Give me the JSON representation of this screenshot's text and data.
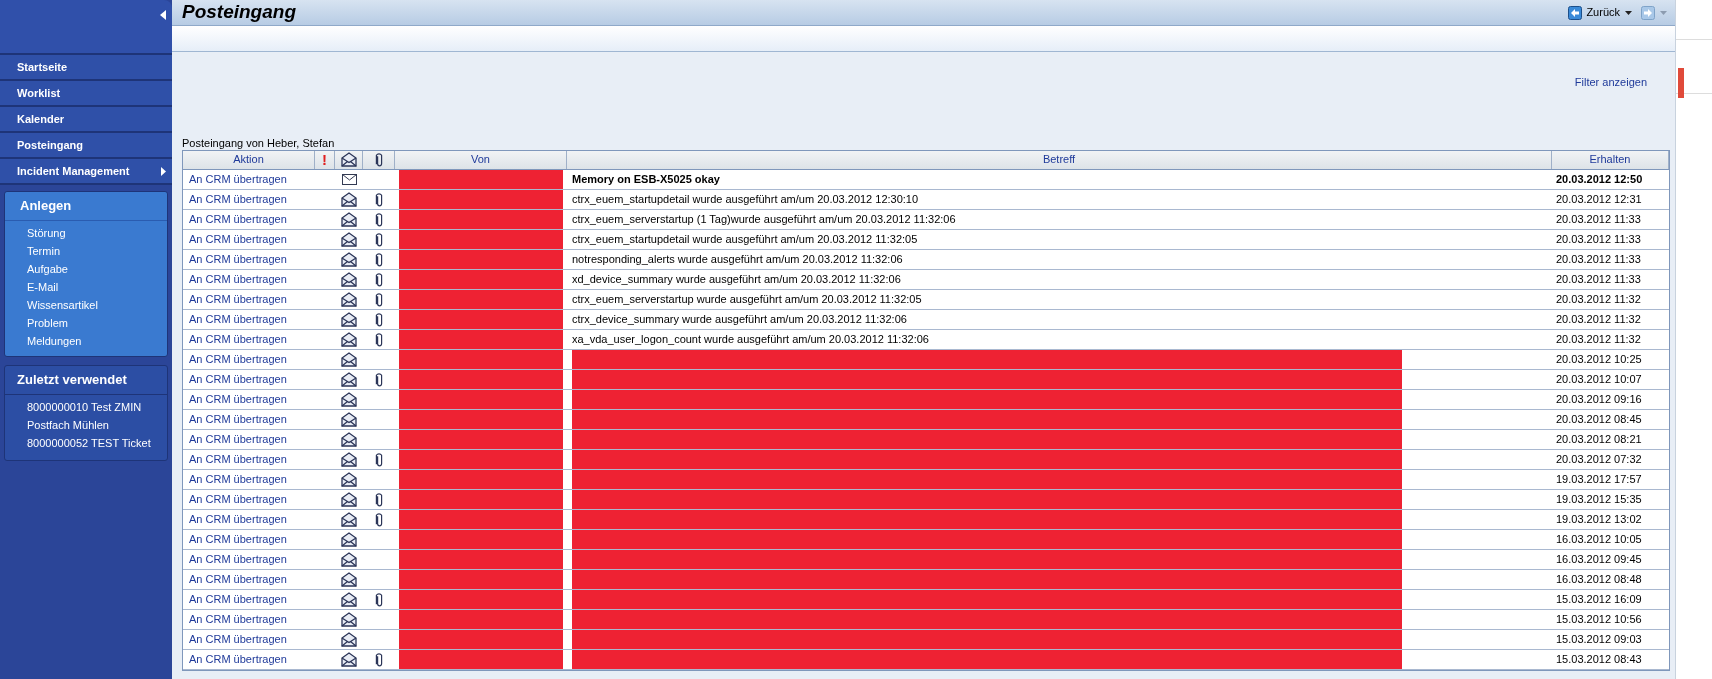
{
  "sidebar": {
    "nav": [
      {
        "label": "Startseite",
        "expandable": false
      },
      {
        "label": "Worklist",
        "expandable": false
      },
      {
        "label": "Kalender",
        "expandable": false
      },
      {
        "label": "Posteingang",
        "expandable": false
      },
      {
        "label": "Incident Management",
        "expandable": true
      }
    ],
    "create": {
      "title": "Anlegen",
      "items": [
        "Störung",
        "Termin",
        "Aufgabe",
        "E-Mail",
        "Wissensartikel",
        "Problem",
        "Meldungen"
      ]
    },
    "recent": {
      "title": "Zuletzt verwendet",
      "items": [
        "8000000010 Test ZMIN",
        "Postfach Mühlen",
        "8000000052 TEST Ticket"
      ]
    }
  },
  "header": {
    "title": "Posteingang",
    "back_button": "Zurück",
    "forward_enabled": false
  },
  "filter_link": "Filter anzeigen",
  "inbox_owner": "Posteingang von Heber, Stefan",
  "table": {
    "columns": [
      {
        "kind": "text",
        "label": "Aktion"
      },
      {
        "kind": "priority",
        "label": "!"
      },
      {
        "kind": "read"
      },
      {
        "kind": "attachment"
      },
      {
        "kind": "text",
        "label": "Von"
      },
      {
        "kind": "text",
        "label": "Betreff"
      },
      {
        "kind": "text",
        "label": "Erhalten"
      }
    ],
    "rows": [
      {
        "action": "An CRM übertragen",
        "unread": true,
        "attachment": false,
        "sender_redacted": true,
        "subject_redacted": false,
        "subject": "Memory on ESB-X5025 okay",
        "received": "20.03.2012 12:50"
      },
      {
        "action": "An CRM übertragen",
        "unread": false,
        "attachment": true,
        "sender_redacted": true,
        "subject_redacted": false,
        "subject": "ctrx_euem_startupdetail wurde ausgeführt am/um 20.03.2012 12:30:10",
        "received": "20.03.2012 12:31"
      },
      {
        "action": "An CRM übertragen",
        "unread": false,
        "attachment": true,
        "sender_redacted": true,
        "subject_redacted": false,
        "subject": "ctrx_euem_serverstartup (1 Tag)wurde ausgeführt am/um 20.03.2012 11:32:06",
        "received": "20.03.2012 11:33"
      },
      {
        "action": "An CRM übertragen",
        "unread": false,
        "attachment": true,
        "sender_redacted": true,
        "subject_redacted": false,
        "subject": "ctrx_euem_startupdetail wurde ausgeführt am/um 20.03.2012 11:32:05",
        "received": "20.03.2012 11:33"
      },
      {
        "action": "An CRM übertragen",
        "unread": false,
        "attachment": true,
        "sender_redacted": true,
        "subject_redacted": false,
        "subject": "notresponding_alerts wurde ausgeführt am/um 20.03.2012 11:32:06",
        "received": "20.03.2012 11:33"
      },
      {
        "action": "An CRM übertragen",
        "unread": false,
        "attachment": true,
        "sender_redacted": true,
        "subject_redacted": false,
        "subject": "xd_device_summary wurde ausgeführt am/um 20.03.2012 11:32:06",
        "received": "20.03.2012 11:33"
      },
      {
        "action": "An CRM übertragen",
        "unread": false,
        "attachment": true,
        "sender_redacted": true,
        "subject_redacted": false,
        "subject": "ctrx_euem_serverstartup wurde ausgeführt am/um 20.03.2012 11:32:05",
        "received": "20.03.2012 11:32"
      },
      {
        "action": "An CRM übertragen",
        "unread": false,
        "attachment": true,
        "sender_redacted": true,
        "subject_redacted": false,
        "subject": "ctrx_device_summary wurde ausgeführt am/um 20.03.2012 11:32:06",
        "received": "20.03.2012 11:32"
      },
      {
        "action": "An CRM übertragen",
        "unread": false,
        "attachment": true,
        "sender_redacted": true,
        "subject_redacted": false,
        "subject": "xa_vda_user_logon_count wurde ausgeführt am/um 20.03.2012 11:32:06",
        "received": "20.03.2012 11:32"
      },
      {
        "action": "An CRM übertragen",
        "unread": false,
        "attachment": false,
        "sender_redacted": true,
        "subject_redacted": true,
        "received": "20.03.2012 10:25"
      },
      {
        "action": "An CRM übertragen",
        "unread": false,
        "attachment": true,
        "sender_redacted": true,
        "subject_redacted": true,
        "received": "20.03.2012 10:07"
      },
      {
        "action": "An CRM übertragen",
        "unread": false,
        "attachment": false,
        "sender_redacted": true,
        "subject_redacted": true,
        "received": "20.03.2012 09:16"
      },
      {
        "action": "An CRM übertragen",
        "unread": false,
        "attachment": false,
        "sender_redacted": true,
        "subject_redacted": true,
        "received": "20.03.2012 08:45"
      },
      {
        "action": "An CRM übertragen",
        "unread": false,
        "attachment": false,
        "sender_redacted": true,
        "subject_redacted": true,
        "received": "20.03.2012 08:21"
      },
      {
        "action": "An CRM übertragen",
        "unread": false,
        "attachment": true,
        "sender_redacted": true,
        "subject_redacted": true,
        "received": "20.03.2012 07:32"
      },
      {
        "action": "An CRM übertragen",
        "unread": false,
        "attachment": false,
        "sender_redacted": true,
        "subject_redacted": true,
        "received": "19.03.2012 17:57"
      },
      {
        "action": "An CRM übertragen",
        "unread": false,
        "attachment": true,
        "sender_redacted": true,
        "subject_redacted": true,
        "received": "19.03.2012 15:35"
      },
      {
        "action": "An CRM übertragen",
        "unread": false,
        "attachment": true,
        "sender_redacted": true,
        "subject_redacted": true,
        "received": "19.03.2012 13:02"
      },
      {
        "action": "An CRM übertragen",
        "unread": false,
        "attachment": false,
        "sender_redacted": true,
        "subject_redacted": true,
        "received": "16.03.2012 10:05"
      },
      {
        "action": "An CRM übertragen",
        "unread": false,
        "attachment": false,
        "sender_redacted": true,
        "subject_redacted": true,
        "received": "16.03.2012 09:45"
      },
      {
        "action": "An CRM übertragen",
        "unread": false,
        "attachment": false,
        "sender_redacted": true,
        "subject_redacted": true,
        "received": "16.03.2012 08:48"
      },
      {
        "action": "An CRM übertragen",
        "unread": false,
        "attachment": true,
        "sender_redacted": true,
        "subject_redacted": true,
        "received": "15.03.2012 16:09"
      },
      {
        "action": "An CRM übertragen",
        "unread": false,
        "attachment": false,
        "sender_redacted": true,
        "subject_redacted": true,
        "received": "15.03.2012 10:56"
      },
      {
        "action": "An CRM übertragen",
        "unread": false,
        "attachment": false,
        "sender_redacted": true,
        "subject_redacted": true,
        "received": "15.03.2012 09:03"
      },
      {
        "action": "An CRM übertragen",
        "unread": false,
        "attachment": true,
        "sender_redacted": true,
        "subject_redacted": true,
        "received": "15.03.2012 08:43"
      }
    ]
  }
}
